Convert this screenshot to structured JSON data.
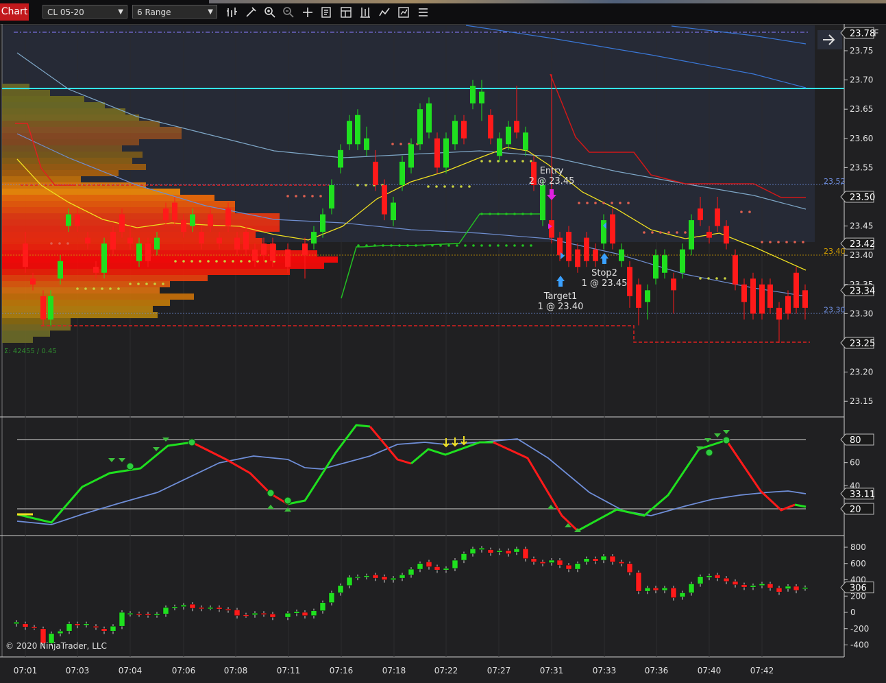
{
  "toolbar": {
    "chart_tab": "Chart",
    "instrument": "CL 05-20",
    "bar_type": "6 Range",
    "icons": [
      "bars-type-icon",
      "draw-pencil-icon",
      "zoom-in-icon",
      "zoom-out-icon",
      "crosshair-icon",
      "properties-icon",
      "data-box-icon",
      "strategies-icon",
      "indicators-icon",
      "chart-trader-icon"
    ]
  },
  "price_panel": {
    "axis_ticks": [
      "23.75",
      "23.70",
      "23.65",
      "23.60",
      "23.55",
      "23.50",
      "23.45",
      "23.40",
      "23.35",
      "23.30",
      "23.25",
      "23.20",
      "23.15"
    ],
    "price_tags": [
      {
        "text": "23.78",
        "color": "#1a1a1a",
        "type": "top"
      },
      {
        "text": "23.50",
        "color": "#1a1a1a"
      },
      {
        "text": "23.42",
        "color": "#1a1a1a"
      },
      {
        "text": "23.34",
        "color": "#1a1a1a"
      },
      {
        "text": "23.25",
        "color": "#1a1a1a"
      }
    ],
    "line_labels": [
      {
        "text": "23.52",
        "color": "#6f8fe0"
      },
      {
        "text": "23.40",
        "color": "#d6a000"
      },
      {
        "text": "23.30",
        "color": "#6f8fe0"
      }
    ],
    "volume_profile_text": "Σ: 42455 / 0.45",
    "orders": {
      "entry": {
        "title": "Entry",
        "detail": "2 @ 23.45"
      },
      "target": {
        "title": "Target1",
        "detail": "1 @ 23.40"
      },
      "stop": {
        "title": "Stop2",
        "detail": "1 @ 23.45"
      }
    },
    "flag": "F"
  },
  "osc_panel": {
    "axis_ticks": [
      "80",
      "60",
      "40",
      "20"
    ],
    "value_tag": "33.11",
    "level_tags": [
      "80",
      "20"
    ]
  },
  "vol_panel": {
    "axis_ticks": [
      "800",
      "600",
      "400",
      "200",
      "0",
      "-200",
      "-400"
    ],
    "value_tag": "306"
  },
  "time_axis": [
    "07:01",
    "07:03",
    "07:04",
    "07:06",
    "07:08",
    "07:11",
    "07:16",
    "07:18",
    "07:22",
    "07:27",
    "07:31",
    "07:33",
    "07:36",
    "07:40",
    "07:42"
  ],
  "copyright": "© 2020 NinjaTrader, LLC",
  "colors": {
    "up": "#1fe01f",
    "down": "#ff1a1a",
    "cyan": "#33e6f0",
    "yellow": "#f0e020"
  }
}
